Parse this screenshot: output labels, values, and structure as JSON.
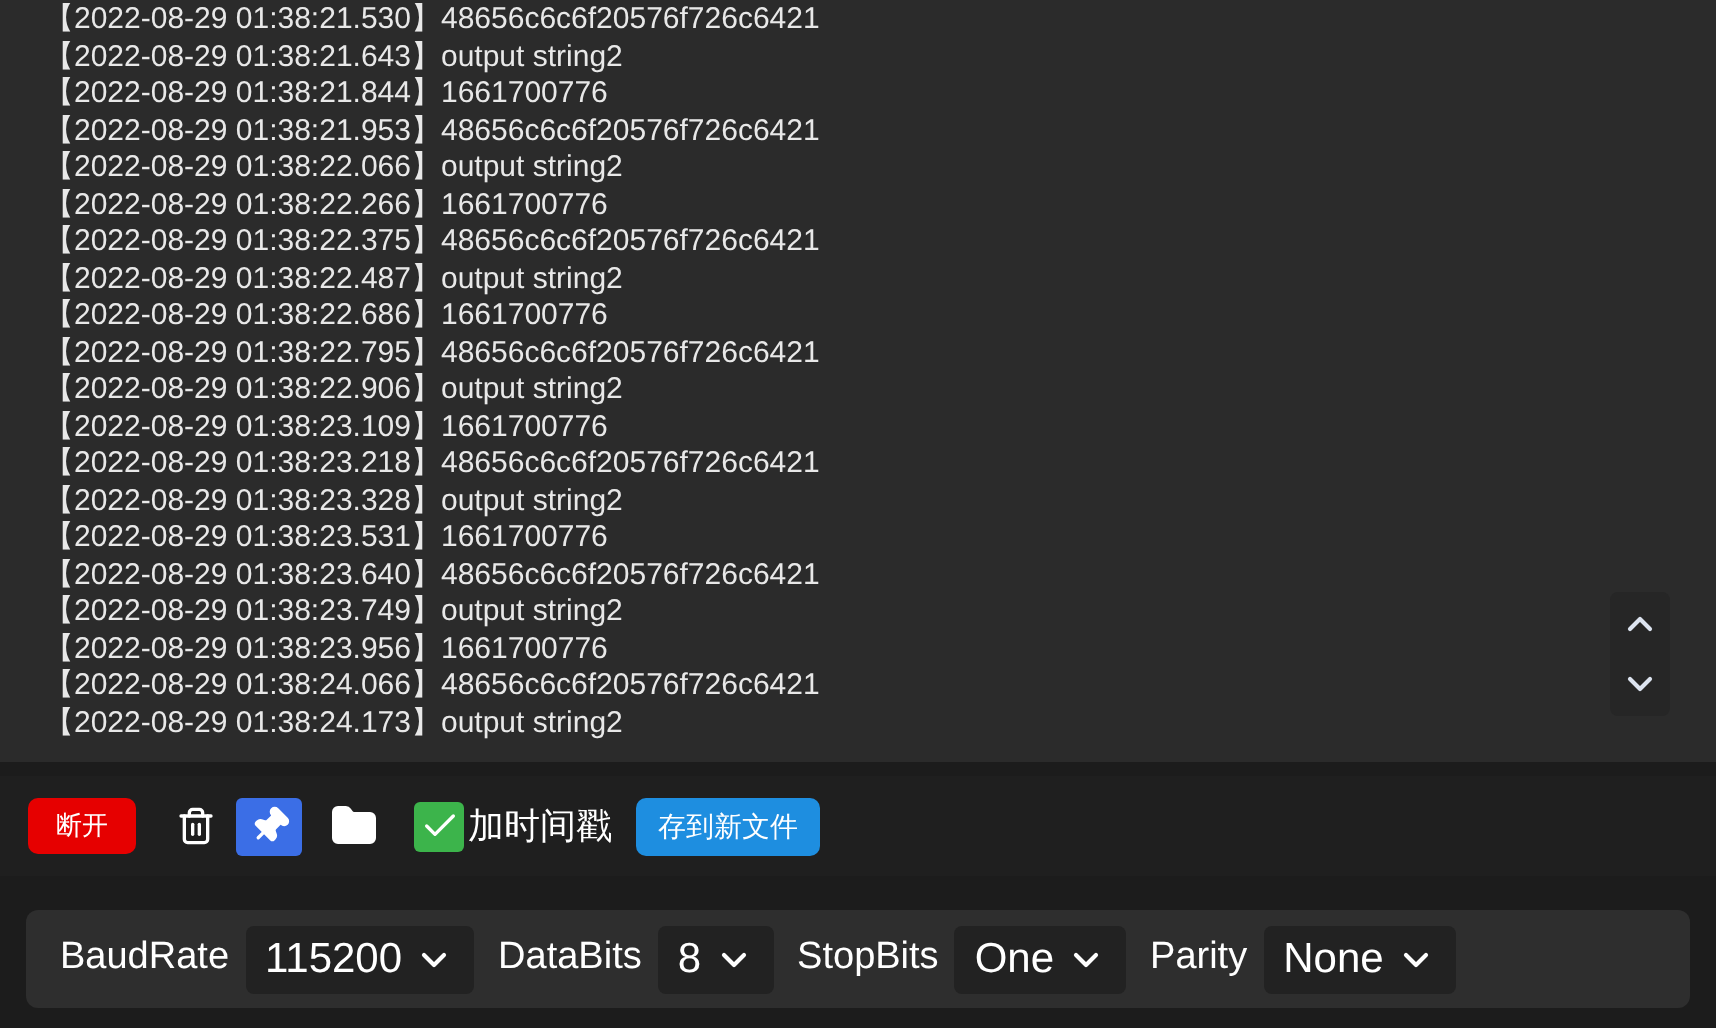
{
  "log": [
    "【2022-08-29 01:38:21.530】48656c6c6f20576f726c6421",
    "【2022-08-29 01:38:21.643】output string2",
    "【2022-08-29 01:38:21.844】1661700776",
    "【2022-08-29 01:38:21.953】48656c6c6f20576f726c6421",
    "【2022-08-29 01:38:22.066】output string2",
    "【2022-08-29 01:38:22.266】1661700776",
    "【2022-08-29 01:38:22.375】48656c6c6f20576f726c6421",
    "【2022-08-29 01:38:22.487】output string2",
    "【2022-08-29 01:38:22.686】1661700776",
    "【2022-08-29 01:38:22.795】48656c6c6f20576f726c6421",
    "【2022-08-29 01:38:22.906】output string2",
    "【2022-08-29 01:38:23.109】1661700776",
    "【2022-08-29 01:38:23.218】48656c6c6f20576f726c6421",
    "【2022-08-29 01:38:23.328】output string2",
    "【2022-08-29 01:38:23.531】1661700776",
    "【2022-08-29 01:38:23.640】48656c6c6f20576f726c6421",
    "【2022-08-29 01:38:23.749】output string2",
    "【2022-08-29 01:38:23.956】1661700776",
    "【2022-08-29 01:38:24.066】48656c6c6f20576f726c6421",
    "【2022-08-29 01:38:24.173】output string2"
  ],
  "toolbar": {
    "disconnect": "断开",
    "pinned": true,
    "timestamp": {
      "label": "加时间戳",
      "checked": true
    },
    "save": "存到新文件"
  },
  "settings": [
    {
      "label": "BaudRate",
      "value": "115200"
    },
    {
      "label": "DataBits",
      "value": "8"
    },
    {
      "label": "StopBits",
      "value": "One"
    },
    {
      "label": "Parity",
      "value": "None"
    }
  ]
}
